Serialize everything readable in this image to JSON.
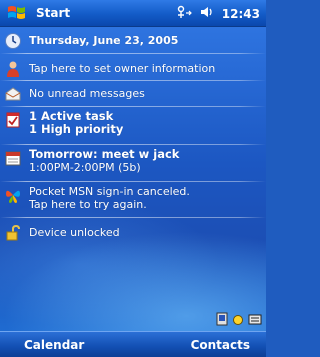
{
  "title_bar": {
    "title": "Start",
    "time": "12:43",
    "icons": [
      "start-flag-icon",
      "connectivity-icon",
      "volume-icon"
    ]
  },
  "today": {
    "date": "Thursday, June 23, 2005",
    "owner": "Tap here to set owner information",
    "messages": "No unread messages",
    "tasks_line1": "1 Active task",
    "tasks_line2": "1 High priority",
    "appt_line1": "Tomorrow: meet w jack",
    "appt_line2": "1:00PM-2:00PM (5b)",
    "msn_line1": "Pocket MSN sign-in canceled.",
    "msn_line2": "Tap here to try again.",
    "device": "Device unlocked"
  },
  "softkeys": {
    "left": "Calendar",
    "right": "Contacts"
  }
}
